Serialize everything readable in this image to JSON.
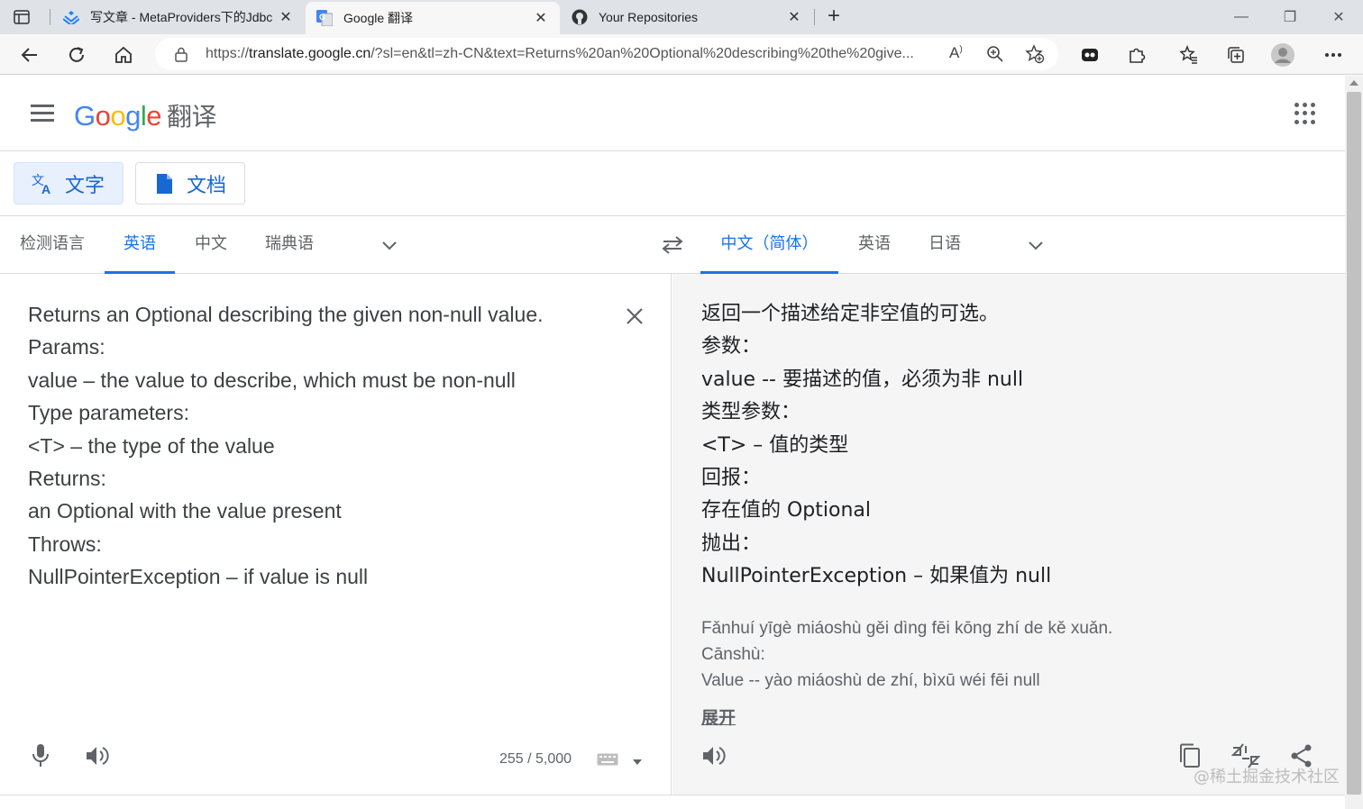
{
  "browser": {
    "tabs": [
      {
        "title": "写文章 - MetaProviders下的Jdbc",
        "active": false
      },
      {
        "title": "Google 翻译",
        "active": true
      },
      {
        "title": "Your Repositories",
        "active": false
      }
    ],
    "url_prefix": "https://",
    "url_host": "translate.google.cn",
    "url_rest": "/?sl=en&tl=zh-CN&text=Returns%20an%20Optional%20describing%20the%20give...",
    "read_aloud_label": "Áʼ"
  },
  "header": {
    "logo_text": "Google",
    "product_name": "翻译"
  },
  "modes": [
    {
      "label": "文字",
      "selected": true
    },
    {
      "label": "文档",
      "selected": false
    }
  ],
  "source_langs": [
    "检测语言",
    "英语",
    "中文",
    "瑞典语"
  ],
  "target_langs": [
    "中文（简体）",
    "英语",
    "日语"
  ],
  "source": {
    "lines": [
      "Returns an Optional describing the given non-null value.",
      "Params:",
      "value – the value to describe, which must be non-null",
      "Type parameters:",
      "<T> – the type of the value",
      "Returns:",
      "an Optional with the value present",
      "Throws:",
      "NullPointerException – if value is null"
    ],
    "char_count": "255 / 5,000"
  },
  "target": {
    "lines": [
      "返回一个描述给定非空值的可选。",
      "参数：",
      "value -- 要描述的值，必须为非 null",
      "类型参数：",
      "<T> – 值的类型",
      "回报：",
      "存在值的 Optional",
      "抛出：",
      "NullPointerException – 如果值为 null"
    ],
    "transliteration": [
      "Fǎnhuí yīgè miáoshù gěi dìng fēi kōng zhí de kě xuǎn.",
      "Cānshù:",
      "Value -- yào miáoshù de zhí, bìxū wéi fēi null"
    ],
    "expand_label": "展开"
  },
  "watermark": "@稀土掘金技术社区",
  "colors": {
    "accent": "#1a73e8",
    "selected_mode_bg": "#e8f0fe",
    "target_bg": "#f5f5f5"
  }
}
